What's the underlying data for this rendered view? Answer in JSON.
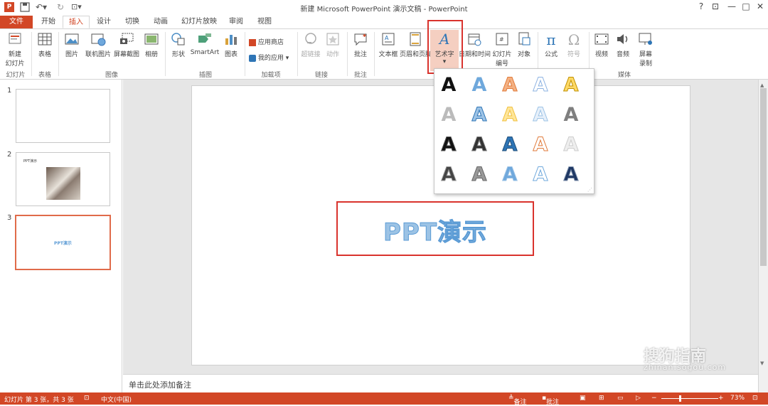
{
  "window": {
    "title": "新建 Microsoft PowerPoint 演示文稿 - PowerPoint",
    "help": "?",
    "restore_icon": "ribbon-display-icon",
    "minimize": "—",
    "maximize": "□",
    "close": "✕"
  },
  "tabs": [
    "文件",
    "开始",
    "插入",
    "设计",
    "切换",
    "动画",
    "幻灯片放映",
    "审阅",
    "视图"
  ],
  "ribbon": {
    "new_slide": "新建",
    "new_slide2": "幻灯片",
    "table": "表格",
    "picture": "图片",
    "online_picture": "联机图片",
    "screenshot": "屏幕截图",
    "album": "相册",
    "shapes": "形状",
    "smartart": "SmartArt",
    "chart": "图表",
    "app_store": "应用商店",
    "my_apps": "我的应用",
    "hyperlink": "超链接",
    "action": "动作",
    "comment": "批注",
    "textbox": "文本框",
    "header_footer": "页眉和页脚",
    "wordart": "艺术字",
    "datetime": "日期和时间",
    "slide_number1": "幻灯片",
    "slide_number2": "编号",
    "object": "对象",
    "equation": "公式",
    "symbol": "符号",
    "video": "视频",
    "audio": "音频",
    "screen_rec1": "屏幕",
    "screen_rec2": "录制",
    "groups": {
      "slides": "幻灯片",
      "tables": "表格",
      "images": "图像",
      "illustrations": "插图",
      "addins": "加载项",
      "links": "链接",
      "comments": "批注",
      "media": "媒体"
    }
  },
  "slides": [
    {
      "number": "1"
    },
    {
      "number": "2",
      "caption": "PPT演示"
    },
    {
      "number": "3",
      "caption": "PPT演示"
    }
  ],
  "canvas": {
    "wordart_text": "PPT演示"
  },
  "notes_placeholder": "单击此处添加备注",
  "status": {
    "slide_info": "幻灯片 第 3 张，共 3 张",
    "language": "中文(中国)",
    "notes": "备注",
    "comments": "批注",
    "zoom": "73%"
  },
  "gallery_glyph": "A",
  "watermark": {
    "brand": "搜狗指南",
    "url": "zhinan.sogou.com"
  },
  "colors": {
    "accent": "#d24726",
    "highlight": "#d9332d",
    "wordart_fill": "#9cc3e5"
  }
}
